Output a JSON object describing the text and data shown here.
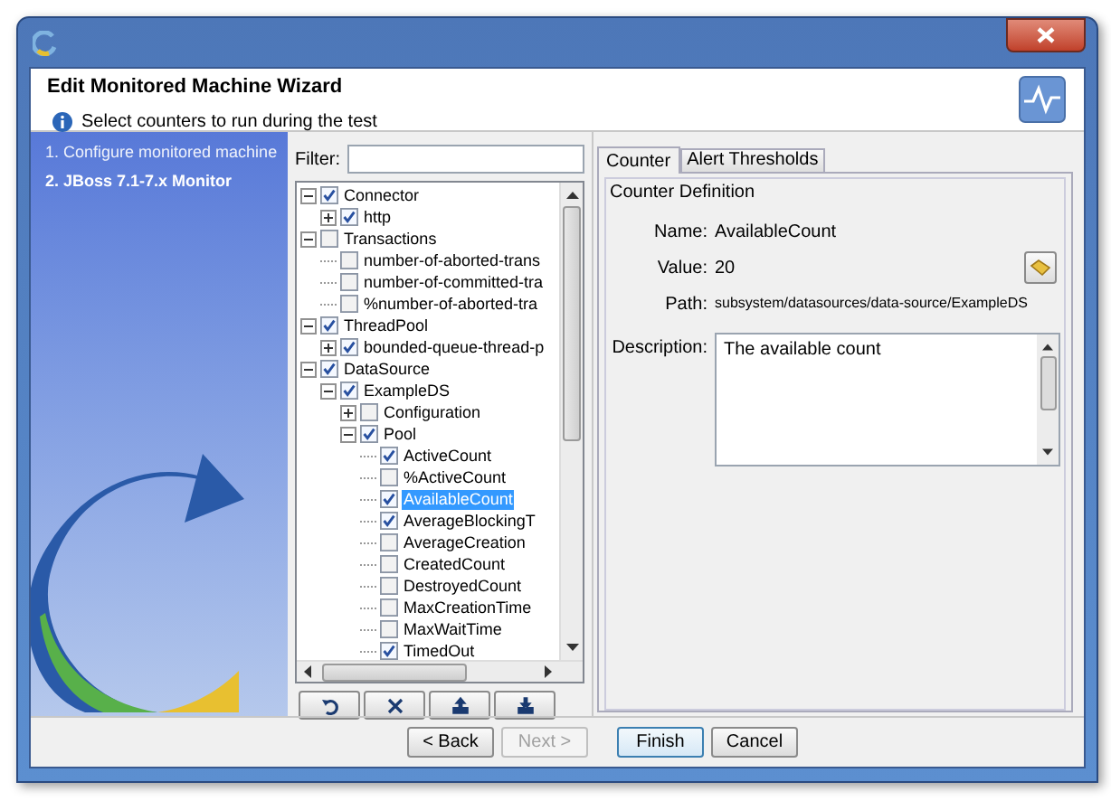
{
  "header": {
    "title": "Edit Monitored Machine Wizard",
    "subtitle": "Select counters to run during the test"
  },
  "steps": [
    {
      "label": "1. Configure monitored machine",
      "selected": false
    },
    {
      "label": "2. JBoss 7.1-7.x Monitor",
      "selected": true
    }
  ],
  "filter": {
    "label": "Filter:"
  },
  "tree": [
    {
      "label": "Connector",
      "checked": true,
      "expanded": true,
      "selected": false,
      "children": [
        {
          "label": "http",
          "checked": true,
          "expanded": false,
          "selected": false
        }
      ]
    },
    {
      "label": "Transactions",
      "checked": false,
      "expanded": true,
      "selected": false,
      "children": [
        {
          "label": "number-of-aborted-trans",
          "checked": false,
          "selected": false
        },
        {
          "label": "number-of-committed-tra",
          "checked": false,
          "selected": false
        },
        {
          "label": "%number-of-aborted-tra",
          "checked": false,
          "selected": false
        }
      ]
    },
    {
      "label": "ThreadPool",
      "checked": true,
      "expanded": true,
      "selected": false,
      "children": [
        {
          "label": "bounded-queue-thread-p",
          "checked": true,
          "expanded": false,
          "selected": false
        }
      ]
    },
    {
      "label": "DataSource",
      "checked": true,
      "expanded": true,
      "selected": false,
      "children": [
        {
          "label": "ExampleDS",
          "checked": true,
          "expanded": true,
          "selected": false,
          "children": [
            {
              "label": "Configuration",
              "checked": false,
              "expanded": false,
              "selected": false
            },
            {
              "label": "Pool",
              "checked": true,
              "expanded": true,
              "selected": false,
              "children": [
                {
                  "label": "ActiveCount",
                  "checked": true,
                  "selected": false
                },
                {
                  "label": "%ActiveCount",
                  "checked": false,
                  "selected": false
                },
                {
                  "label": "AvailableCount",
                  "checked": true,
                  "selected": true
                },
                {
                  "label": "AverageBlockingT",
                  "checked": true,
                  "selected": false
                },
                {
                  "label": "AverageCreation",
                  "checked": false,
                  "selected": false
                },
                {
                  "label": "CreatedCount",
                  "checked": false,
                  "selected": false
                },
                {
                  "label": "DestroyedCount",
                  "checked": false,
                  "selected": false
                },
                {
                  "label": "MaxCreationTime",
                  "checked": false,
                  "selected": false
                },
                {
                  "label": "MaxWaitTime",
                  "checked": false,
                  "selected": false
                },
                {
                  "label": "TimedOut",
                  "checked": true,
                  "selected": false
                }
              ]
            }
          ]
        }
      ]
    }
  ],
  "tree_buttons": [
    {
      "kind": "undo"
    },
    {
      "kind": "delete"
    },
    {
      "kind": "export"
    },
    {
      "kind": "import"
    }
  ],
  "tabs": [
    {
      "label": "Counter",
      "selected": true
    },
    {
      "label": "Alert Thresholds",
      "selected": false
    }
  ],
  "counter": {
    "group": "Counter Definition",
    "fields": [
      {
        "label": "Name:",
        "value": "AvailableCount"
      },
      {
        "label": "Value:",
        "value": "20"
      },
      {
        "label": "Path:",
        "value": "subsystem/datasources/data-source/ExampleDS"
      }
    ],
    "description_label": "Description:",
    "description": "The available count"
  },
  "buttons": [
    {
      "label": "< Back",
      "disabled": false,
      "default": false
    },
    {
      "label": "Next >",
      "disabled": true,
      "default": false
    },
    {
      "label": "Finish",
      "disabled": false,
      "default": true
    },
    {
      "label": "Cancel",
      "disabled": false,
      "default": false
    }
  ]
}
